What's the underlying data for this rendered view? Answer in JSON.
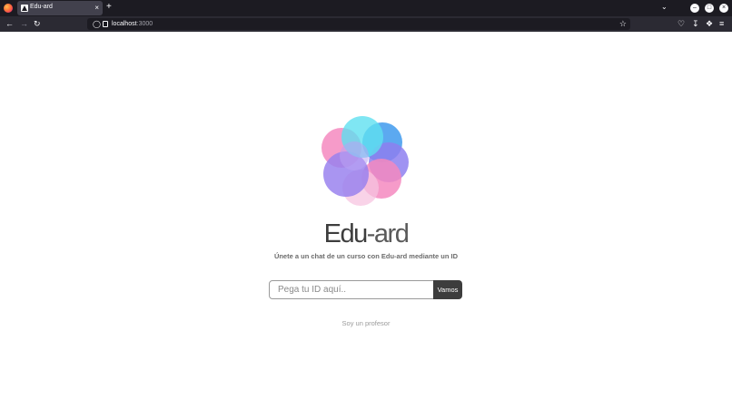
{
  "browser": {
    "tab_title": "Edu-ard",
    "tab_close": "×",
    "new_tab": "+",
    "url_host": "localhost",
    "url_port": ":3000"
  },
  "page": {
    "brand_part1": "Edu",
    "brand_part2": "-ard",
    "tagline": "Únete a un chat de un curso con Edu-ard mediante un ID",
    "id_placeholder": "Pega tu ID aquí..",
    "submit_label": "Vamos",
    "teacher_link": "Soy un profesor"
  },
  "colors": {
    "brand_dark": "#3d3d3d",
    "logo_cyan": "#5fe0f0",
    "logo_blue": "#4aa0ee",
    "logo_pink": "#f58ac0",
    "logo_purple": "#9a82ee",
    "logo_violet": "#b9a2f2"
  }
}
